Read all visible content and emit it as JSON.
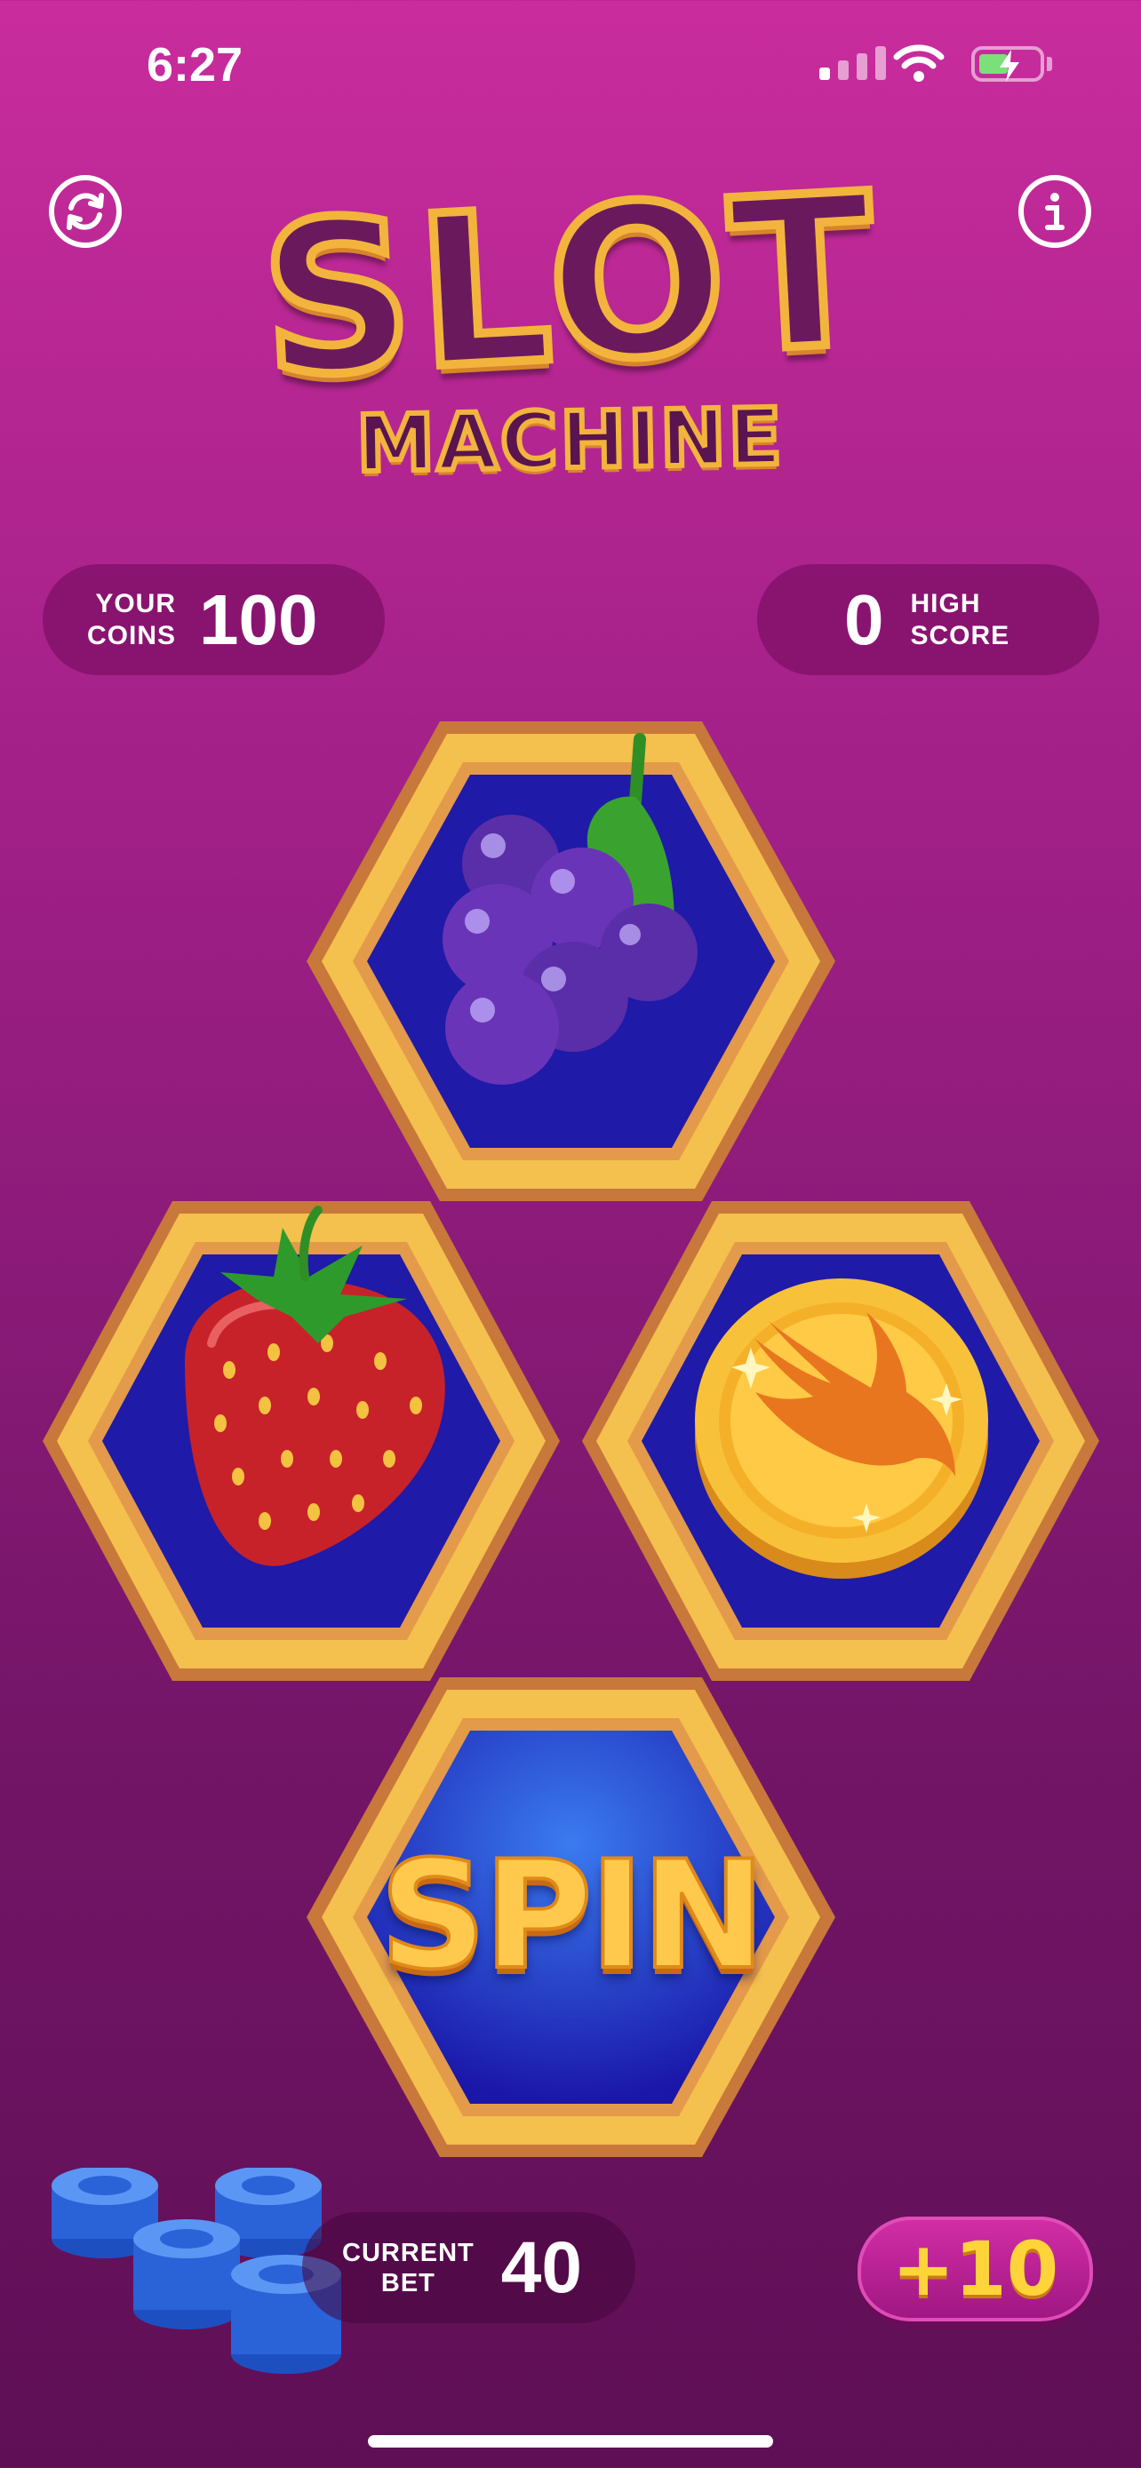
{
  "status_bar": {
    "time": "6:27"
  },
  "header": {
    "logo_line1": "SLOT",
    "logo_line2": "MACHINE"
  },
  "stats": {
    "coins_label_line1": "YOUR",
    "coins_label_line2": "COINS",
    "coins_value": "100",
    "high_score_value": "0",
    "high_score_label_line1": "HIGH",
    "high_score_label_line2": "SCORE"
  },
  "reels": [
    {
      "symbol": "grapes-icon"
    },
    {
      "symbol": "strawberry-icon"
    },
    {
      "symbol": "swift-coin-icon"
    }
  ],
  "spin": {
    "label": "SPIN"
  },
  "bet": {
    "label_line1": "CURRENT",
    "label_line2": "BET",
    "value": "40",
    "increase_label": "+10"
  },
  "colors": {
    "hex_gold": "#f4c04e",
    "hex_rim": "#c8783a",
    "hex_fill": "#1f1aa8",
    "background_top": "#c92c9d"
  }
}
